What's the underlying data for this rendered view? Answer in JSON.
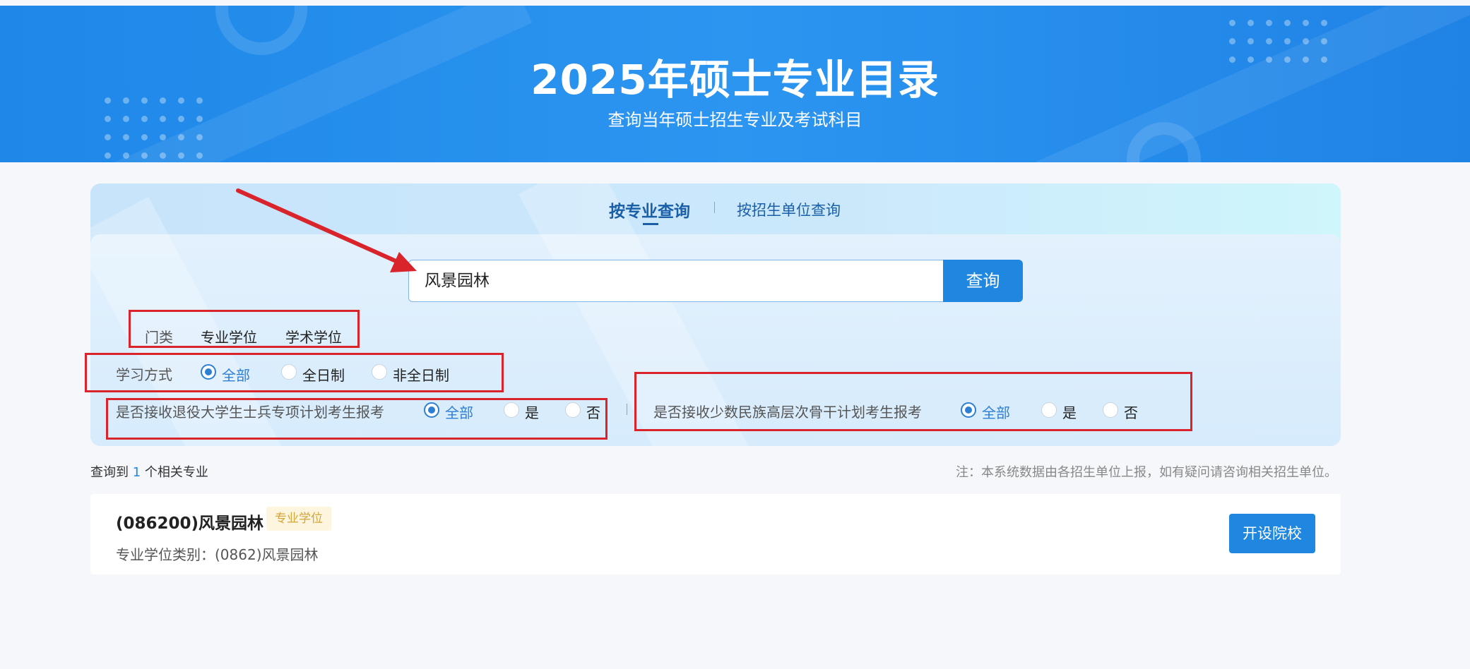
{
  "banner": {
    "title": "2025年硕士专业目录",
    "subtitle": "查询当年硕士招生专业及考试科目"
  },
  "tabs": {
    "active": "按专业查询",
    "other": "按招生单位查询"
  },
  "search": {
    "value": "风景园林",
    "button_label": "查询"
  },
  "filters": {
    "category": {
      "label": "门类",
      "options": [
        "专业学位",
        "学术学位"
      ]
    },
    "study_mode": {
      "label": "学习方式",
      "options": [
        "全部",
        "全日制",
        "非全日制"
      ],
      "selected": "全部"
    },
    "veteran_plan": {
      "label": "是否接收退役大学生士兵专项计划考生报考",
      "options": [
        "全部",
        "是",
        "否"
      ],
      "selected": "全部"
    },
    "minority_plan": {
      "label": "是否接收少数民族高层次骨干计划考生报考",
      "options": [
        "全部",
        "是",
        "否"
      ],
      "selected": "全部"
    }
  },
  "results": {
    "prefix": "查询到",
    "count": "1",
    "suffix": "个相关专业",
    "note": "注：本系统数据由各招生单位上报，如有疑问请咨询相关招生单位。",
    "items": [
      {
        "title": "(086200)风景园林",
        "badge": "专业学位",
        "subtitle": "专业学位类别：(0862)风景园林",
        "button_label": "开设院校"
      }
    ]
  },
  "colors": {
    "primary": "#1f87e0",
    "annotation_red": "#d9242c",
    "badge_text": "#d1a63a",
    "badge_bg": "#fdf5de"
  }
}
